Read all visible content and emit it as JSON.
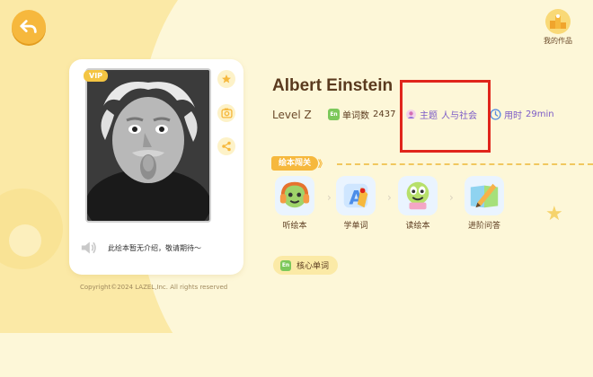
{
  "header": {
    "back_icon": "back-arrow-icon",
    "my_works_label": "我的作品",
    "my_works_icon": "trophy-icon"
  },
  "card": {
    "vip_label": "VIP",
    "cover_icon": "einstein-portrait",
    "side_icons": [
      "star-icon",
      "photo-icon",
      "share-icon"
    ],
    "intro_text": "此绘本暂无介绍，敬请期待～",
    "sound_icon": "speaker-icon"
  },
  "copyright": "Copyright©2024 LAZEL,Inc. All rights reserved",
  "book": {
    "title": "Albert Einstein",
    "level": "Level Z",
    "word_count_label": "单词数",
    "word_count_value": "2437",
    "theme_label": "主题",
    "theme_value": "人与社会",
    "time_label": "用时",
    "time_value": "29min"
  },
  "section": {
    "title": "绘本闯关",
    "arrows": "》"
  },
  "steps": [
    {
      "label": "听绘本",
      "icon": "listen-icon"
    },
    {
      "label": "学单词",
      "icon": "learn-words-icon"
    },
    {
      "label": "读绘本",
      "icon": "read-icon"
    },
    {
      "label": "进阶问答",
      "icon": "quiz-icon"
    }
  ],
  "vocab_button": {
    "badge": "En",
    "label": "核心单词"
  },
  "colors": {
    "accent": "#f6b83d",
    "highlight_box": "#e0251b",
    "title": "#5a3a1e",
    "theme_text": "#7b5bc7"
  }
}
